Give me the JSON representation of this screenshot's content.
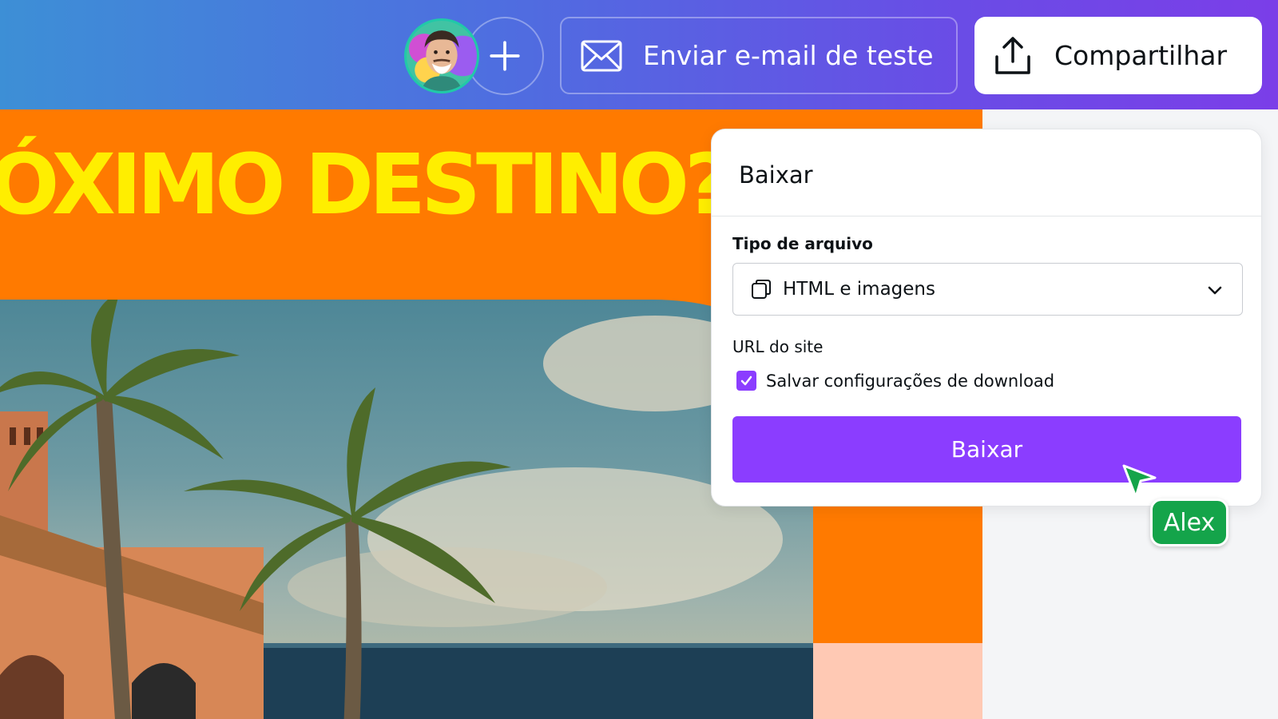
{
  "header": {
    "avatar_label": "Perfil do usuário",
    "email_button": "Enviar e-mail de teste",
    "share_button": "Compartilhar"
  },
  "design": {
    "headline": "ÓXIMO DESTINO?"
  },
  "download_panel": {
    "title": "Baixar",
    "file_type_label": "Tipo de arquivo",
    "file_type_value": "HTML e imagens",
    "site_url_label": "URL do site",
    "save_settings_label": "Salvar configurações de download",
    "save_settings_checked": true,
    "download_button": "Baixar"
  },
  "collaborator": {
    "name": "Alex"
  },
  "colors": {
    "accent": "#8b3dff",
    "design_orange": "#ff7a00",
    "headline_yellow": "#ffee00",
    "collaborator_green": "#14a44a"
  },
  "icons": {
    "add": "plus-icon",
    "email": "envelope-icon",
    "share": "upload-icon",
    "file_type": "copy-icon",
    "dropdown": "chevron-down-icon",
    "checkbox": "check-icon",
    "cursor": "pointer-cursor-icon"
  }
}
